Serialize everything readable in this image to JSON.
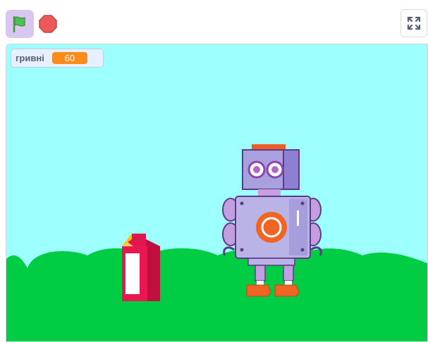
{
  "toolbar": {
    "green_flag_icon": "green-flag-icon",
    "stop_icon": "stop-sign-icon",
    "fullscreen_icon": "fullscreen-icon"
  },
  "stage": {
    "sky_color": "#9effff",
    "ground_color": "#00cc44",
    "variable_monitor": {
      "name": "гривні",
      "value": "60"
    },
    "sprites": [
      "milk-carton",
      "robot"
    ]
  }
}
